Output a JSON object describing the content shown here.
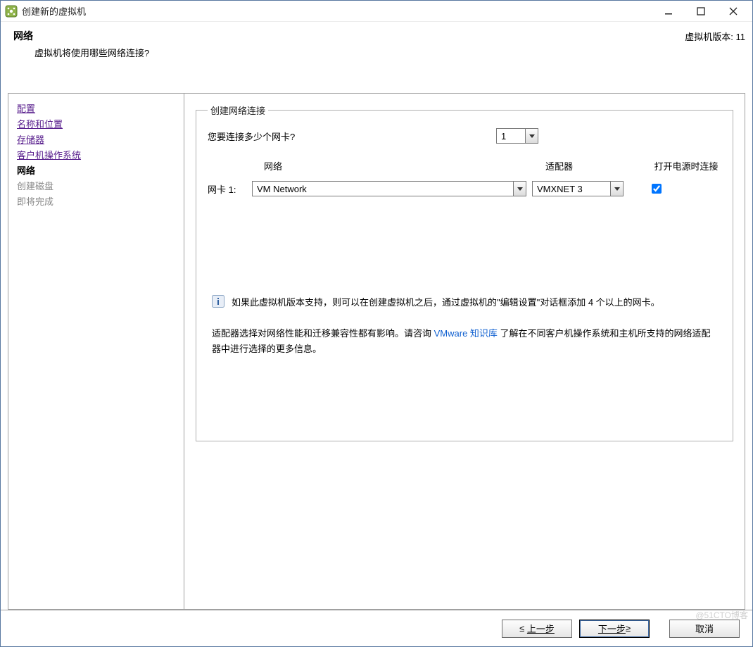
{
  "window": {
    "title": "创建新的虚拟机"
  },
  "header": {
    "title": "网络",
    "desc": "虚拟机将使用哪些网络连接?",
    "version_label": "虚拟机版本: 11"
  },
  "sidebar": {
    "items": [
      {
        "label": "配置",
        "state": "link"
      },
      {
        "label": "名称和位置",
        "state": "link"
      },
      {
        "label": "存储器",
        "state": "link"
      },
      {
        "label": "客户机操作系统",
        "state": "link"
      },
      {
        "label": "网络",
        "state": "current"
      },
      {
        "label": "创建磁盘",
        "state": "pending"
      },
      {
        "label": "即将完成",
        "state": "pending"
      }
    ]
  },
  "group": {
    "legend": "创建网络连接",
    "question": "您要连接多少个网卡?",
    "count_value": "1",
    "col_network": "网络",
    "col_adapter": "适配器",
    "col_power": "打开电源时连接",
    "nic_label": "网卡 1:",
    "network_value": "VM Network",
    "adapter_value": "VMXNET 3",
    "power_checked": true,
    "info_text": "如果此虚拟机版本支持，则可以在创建虚拟机之后，通过虚拟机的\"编辑设置\"对话框添加 4 个以上的网卡。",
    "kb_pre": "适配器选择对网络性能和迁移兼容性都有影响。请咨询 ",
    "kb_link": "VMware 知识库",
    "kb_post": " 了解在不同客户机操作系统和主机所支持的网络适配器中进行选择的更多信息。"
  },
  "footer": {
    "back_prefix": "≤",
    "back_text": "上一步",
    "next_text": "下一步",
    "next_suffix": " ≥",
    "cancel_text": "取消"
  },
  "watermark": "@51CTO博客"
}
